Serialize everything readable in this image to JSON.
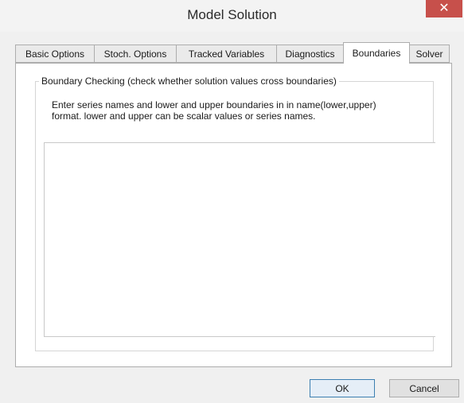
{
  "window": {
    "title": "Model Solution",
    "close_glyph": "✕"
  },
  "tabs": [
    {
      "label": "Basic Options",
      "active": false
    },
    {
      "label": "Stoch. Options",
      "active": false
    },
    {
      "label": "Tracked Variables",
      "active": false
    },
    {
      "label": "Diagnostics",
      "active": false
    },
    {
      "label": "Boundaries",
      "active": true
    },
    {
      "label": "Solver",
      "active": false
    }
  ],
  "boundaries": {
    "group_title": "Boundary Checking (check whether solution values cross boundaries)",
    "instructions_line1": "Enter series names and lower and upper boundaries in in name(lower,upper)",
    "instructions_line2": "format.  lower and upper can be scalar values or series names.",
    "entry_value": ""
  },
  "buttons": {
    "ok": "OK",
    "cancel": "Cancel"
  },
  "colors": {
    "close_button": "#c7504b",
    "window_bg": "#f0f0f0",
    "panel_bg": "#ffffff"
  }
}
